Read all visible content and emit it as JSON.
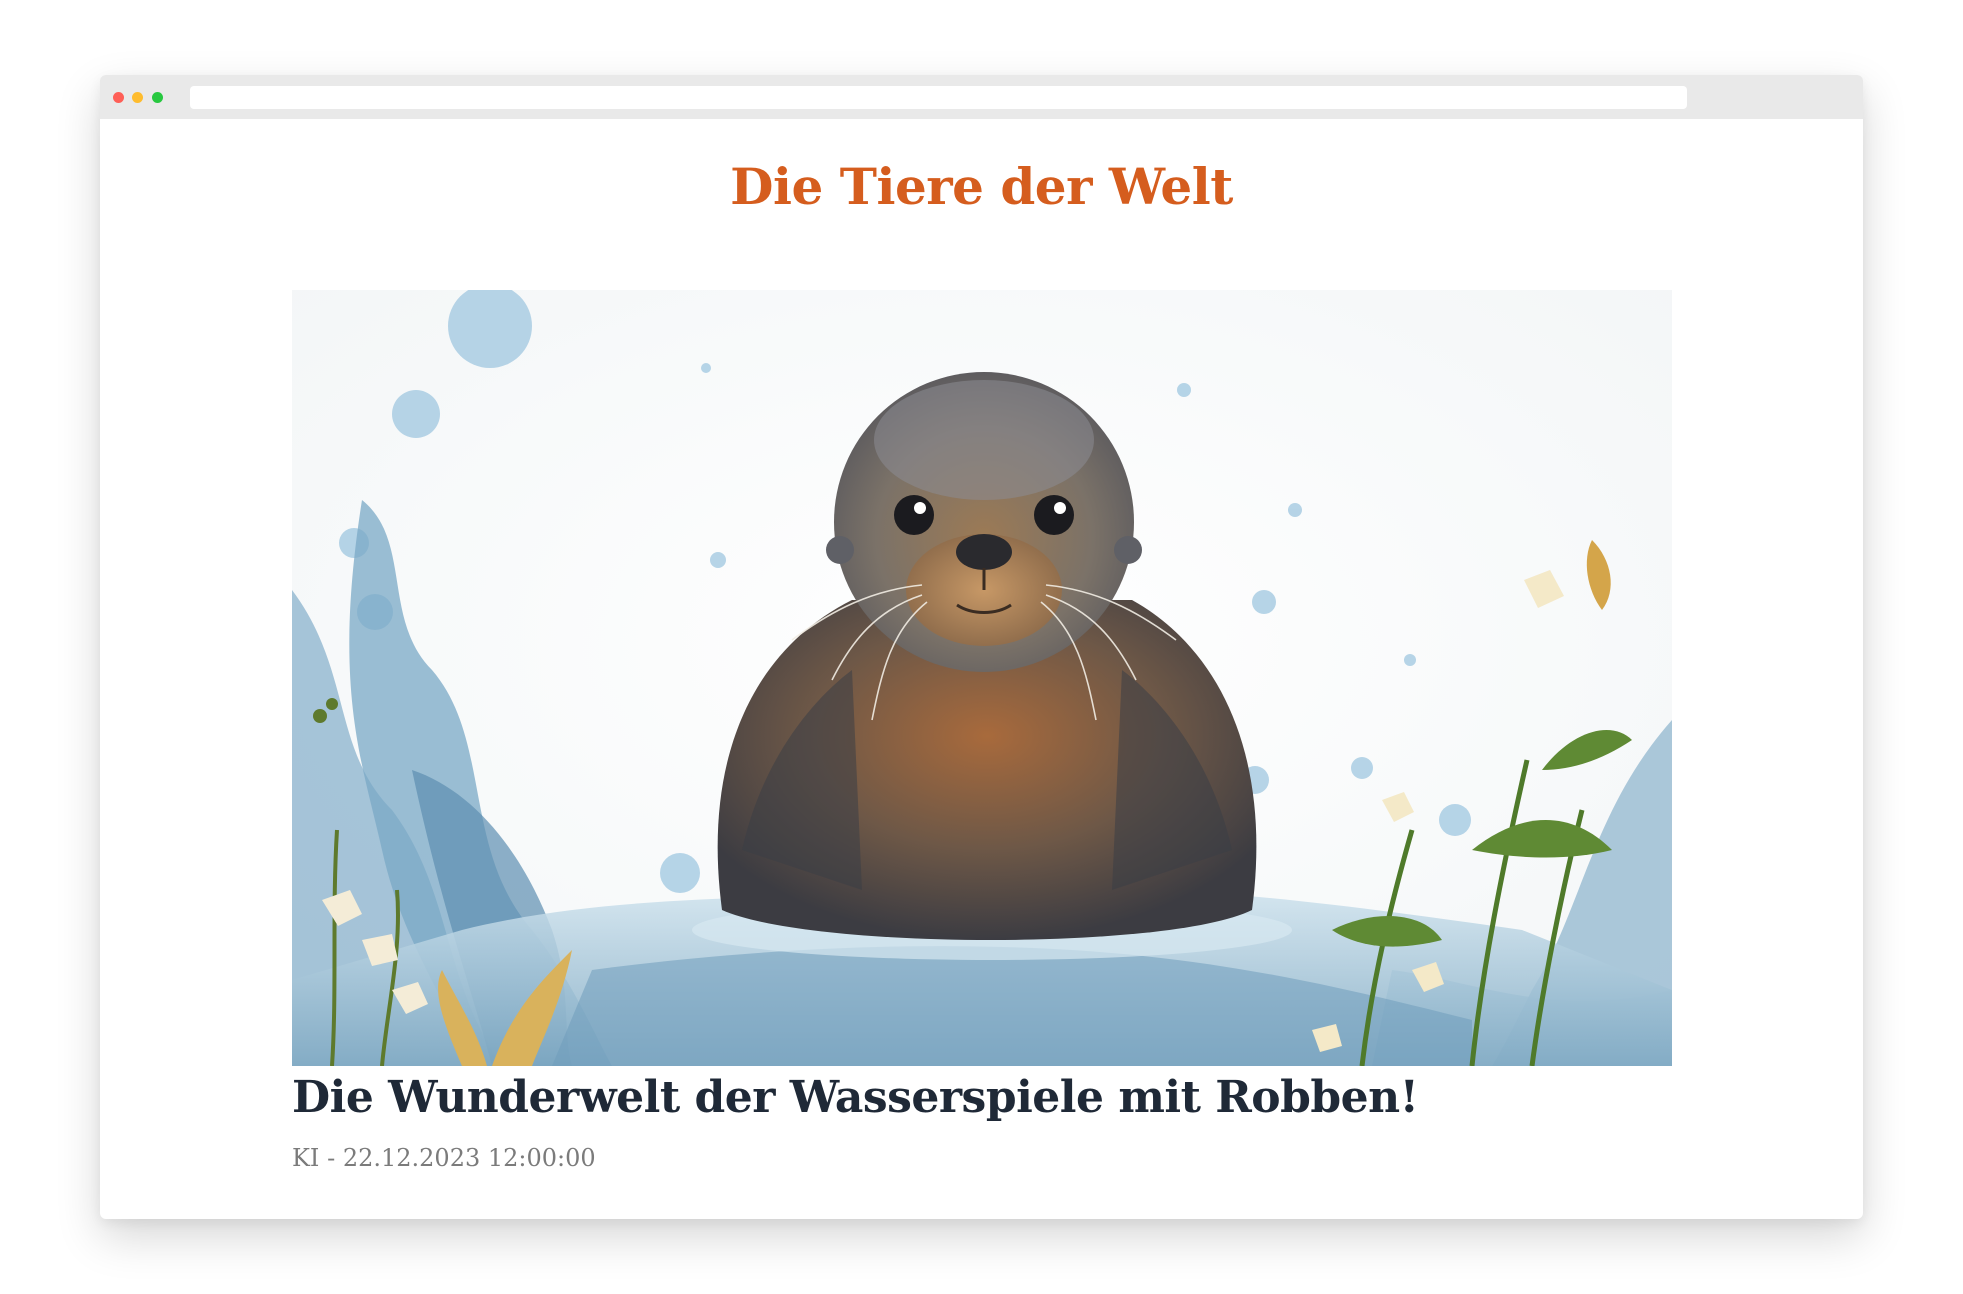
{
  "header": {
    "site_title": "Die Tiere der Welt"
  },
  "article": {
    "title": "Die Wunderwelt der Wasserspiele mit Robben!",
    "author": "KI",
    "separator": "-",
    "date": "22.12.2023 12:00:00"
  },
  "colors": {
    "title": "#d55d1e",
    "article_title": "#1f2937",
    "meta": "#7b7b7b"
  }
}
